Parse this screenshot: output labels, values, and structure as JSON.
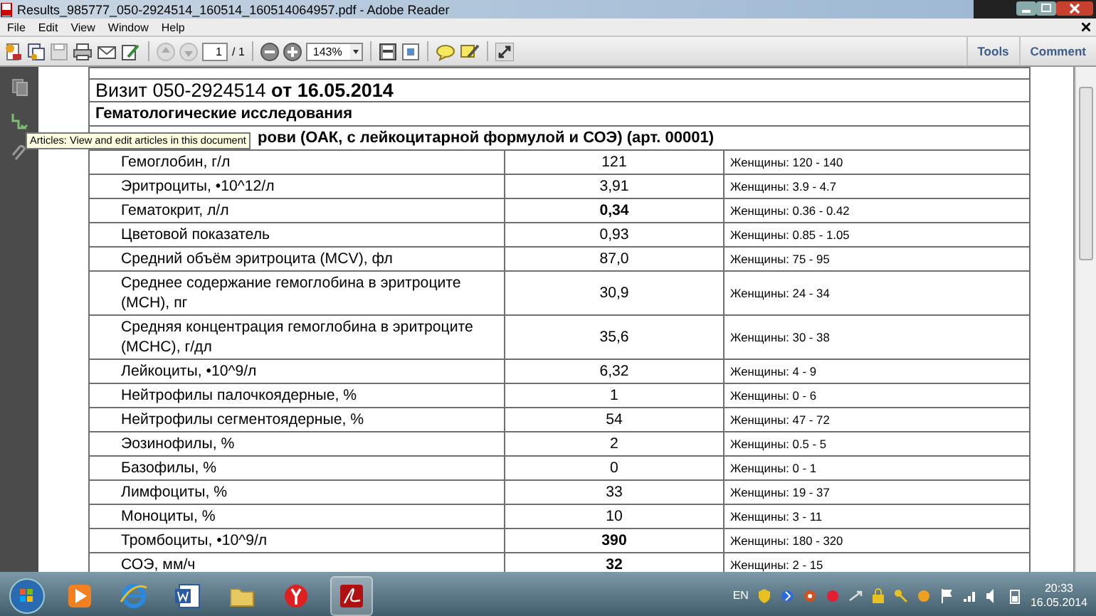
{
  "window": {
    "title": "Results_985777_050-2924514_160514_160514064957.pdf - Adobe Reader"
  },
  "menu": [
    "File",
    "Edit",
    "View",
    "Window",
    "Help"
  ],
  "toolbar": {
    "page": "1",
    "page_count": "/ 1",
    "zoom": "143%",
    "buttons": [
      "Tools",
      "Comment"
    ]
  },
  "tooltip": "Articles: View and edit articles in this document",
  "document": {
    "visit": "Визит 050-2924514 **от 16.05.2014**",
    "section": "Гематологические исследования",
    "panel": "рови (ОАК, с лейкоцитарной формулой и СОЭ) (арт. 00001)",
    "rows": [
      {
        "name": "Гемоглобин, г/л",
        "value": "121",
        "bold": false,
        "reference": "Женщины: 120 - 140"
      },
      {
        "name": "Эритроциты, •10^12/л",
        "value": "3,91",
        "bold": false,
        "reference": "Женщины: 3.9 - 4.7"
      },
      {
        "name": "Гематокрит, л/л",
        "value": "0,34",
        "bold": true,
        "reference": "Женщины: 0.36 - 0.42"
      },
      {
        "name": "Цветовой показатель",
        "value": "0,93",
        "bold": false,
        "reference": "Женщины: 0.85 - 1.05"
      },
      {
        "name": "Средний объём эритроцита (MCV), фл",
        "value": "87,0",
        "bold": false,
        "reference": "Женщины: 75 - 95"
      },
      {
        "name": "Среднее содержание гемоглобина в эритроците (MCH), пг",
        "value": "30,9",
        "bold": false,
        "reference": "Женщины: 24 - 34"
      },
      {
        "name": "Средняя концентрация гемоглобина в эритроците (МСНС), г/дл",
        "value": "35,6",
        "bold": false,
        "reference": "Женщины: 30 - 38"
      },
      {
        "name": "Лейкоциты, •10^9/л",
        "value": "6,32",
        "bold": false,
        "reference": "Женщины: 4 - 9"
      },
      {
        "name": "Нейтрофилы палочкоядерные, %",
        "value": "1",
        "bold": false,
        "reference": "Женщины: 0 - 6"
      },
      {
        "name": "Нейтрофилы сегментоядерные, %",
        "value": "54",
        "bold": false,
        "reference": "Женщины: 47 - 72"
      },
      {
        "name": "Эозинофилы, %",
        "value": "2",
        "bold": false,
        "reference": "Женщины: 0.5 - 5"
      },
      {
        "name": "Базофилы, %",
        "value": "0",
        "bold": false,
        "reference": "Женщины: 0 - 1"
      },
      {
        "name": "Лимфоциты, %",
        "value": "33",
        "bold": false,
        "reference": "Женщины: 19 - 37"
      },
      {
        "name": "Моноциты, %",
        "value": "10",
        "bold": false,
        "reference": "Женщины: 3 - 11"
      },
      {
        "name": "Тромбоциты, •10^9/л",
        "value": "390",
        "bold": true,
        "reference": "Женщины: 180 - 320"
      },
      {
        "name": "СОЭ, мм/ч",
        "value": "32",
        "bold": true,
        "reference": "Женщины: 2 - 15"
      }
    ]
  },
  "taskbar": {
    "language": "EN",
    "time": "20:33",
    "date": "16.05.2014"
  }
}
